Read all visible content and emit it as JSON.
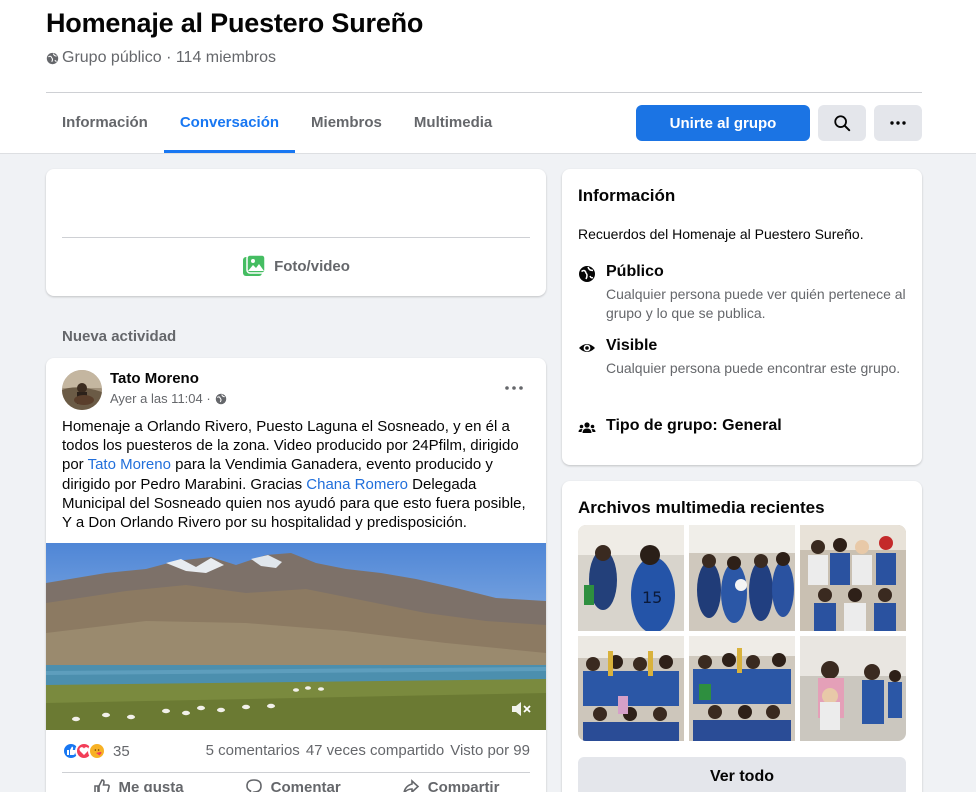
{
  "group": {
    "title": "Homenaje al Puestero Sureño",
    "meta": "Grupo público · 114 miembros"
  },
  "tabs": [
    {
      "label": "Información"
    },
    {
      "label": "Conversación",
      "active": true
    },
    {
      "label": "Miembros"
    },
    {
      "label": "Multimedia"
    }
  ],
  "toolbar": {
    "join_label": "Unirte al grupo",
    "search_icon": "search-icon",
    "more_icon": "more-icon"
  },
  "composer": {
    "photo_label": "Foto/video"
  },
  "feed": {
    "section_label": "Nueva actividad"
  },
  "post": {
    "author": "Tato Moreno",
    "time": "Ayer a las 11:04 ·",
    "text_1": "Homenaje a Orlando Rivero, Puesto Laguna el Sosneado, y en él a todos los puesteros de la zona. Video producido por 24Pfilm, dirigido por ",
    "link_1": "Tato Moreno",
    "text_2": " para la Vendimia Ganadera, evento producido y dirigido por Pedro Marabini. Gracias ",
    "link_2": "Chana Romero",
    "text_3": " Delegada Municipal del Sosneado quien nos ayudó para que esto fuera posible, Y a Don Orlando Rivero por su hospitalidad y predisposición.",
    "reaction_count": "35",
    "comments": "5 comentarios",
    "shares": "47 veces compartido",
    "views": "Visto por 99",
    "like_label": "Me gusta",
    "comment_label": "Comentar",
    "share_label": "Compartir"
  },
  "info": {
    "title": "Información",
    "description": "Recuerdos del Homenaje al Puestero Sureño.",
    "public_title": "Público",
    "public_desc": "Cualquier persona puede ver quién pertenece al grupo y lo que se publica.",
    "visible_title": "Visible",
    "visible_desc": "Cualquier persona puede encontrar este grupo.",
    "type_title": "Tipo de grupo: General"
  },
  "media": {
    "title": "Archivos multimedia recientes",
    "see_all": "Ver todo"
  },
  "colors": {
    "accent": "#1b74e4",
    "link": "#216fdb",
    "secondary_text": "#65676b",
    "background": "#f0f2f5"
  }
}
